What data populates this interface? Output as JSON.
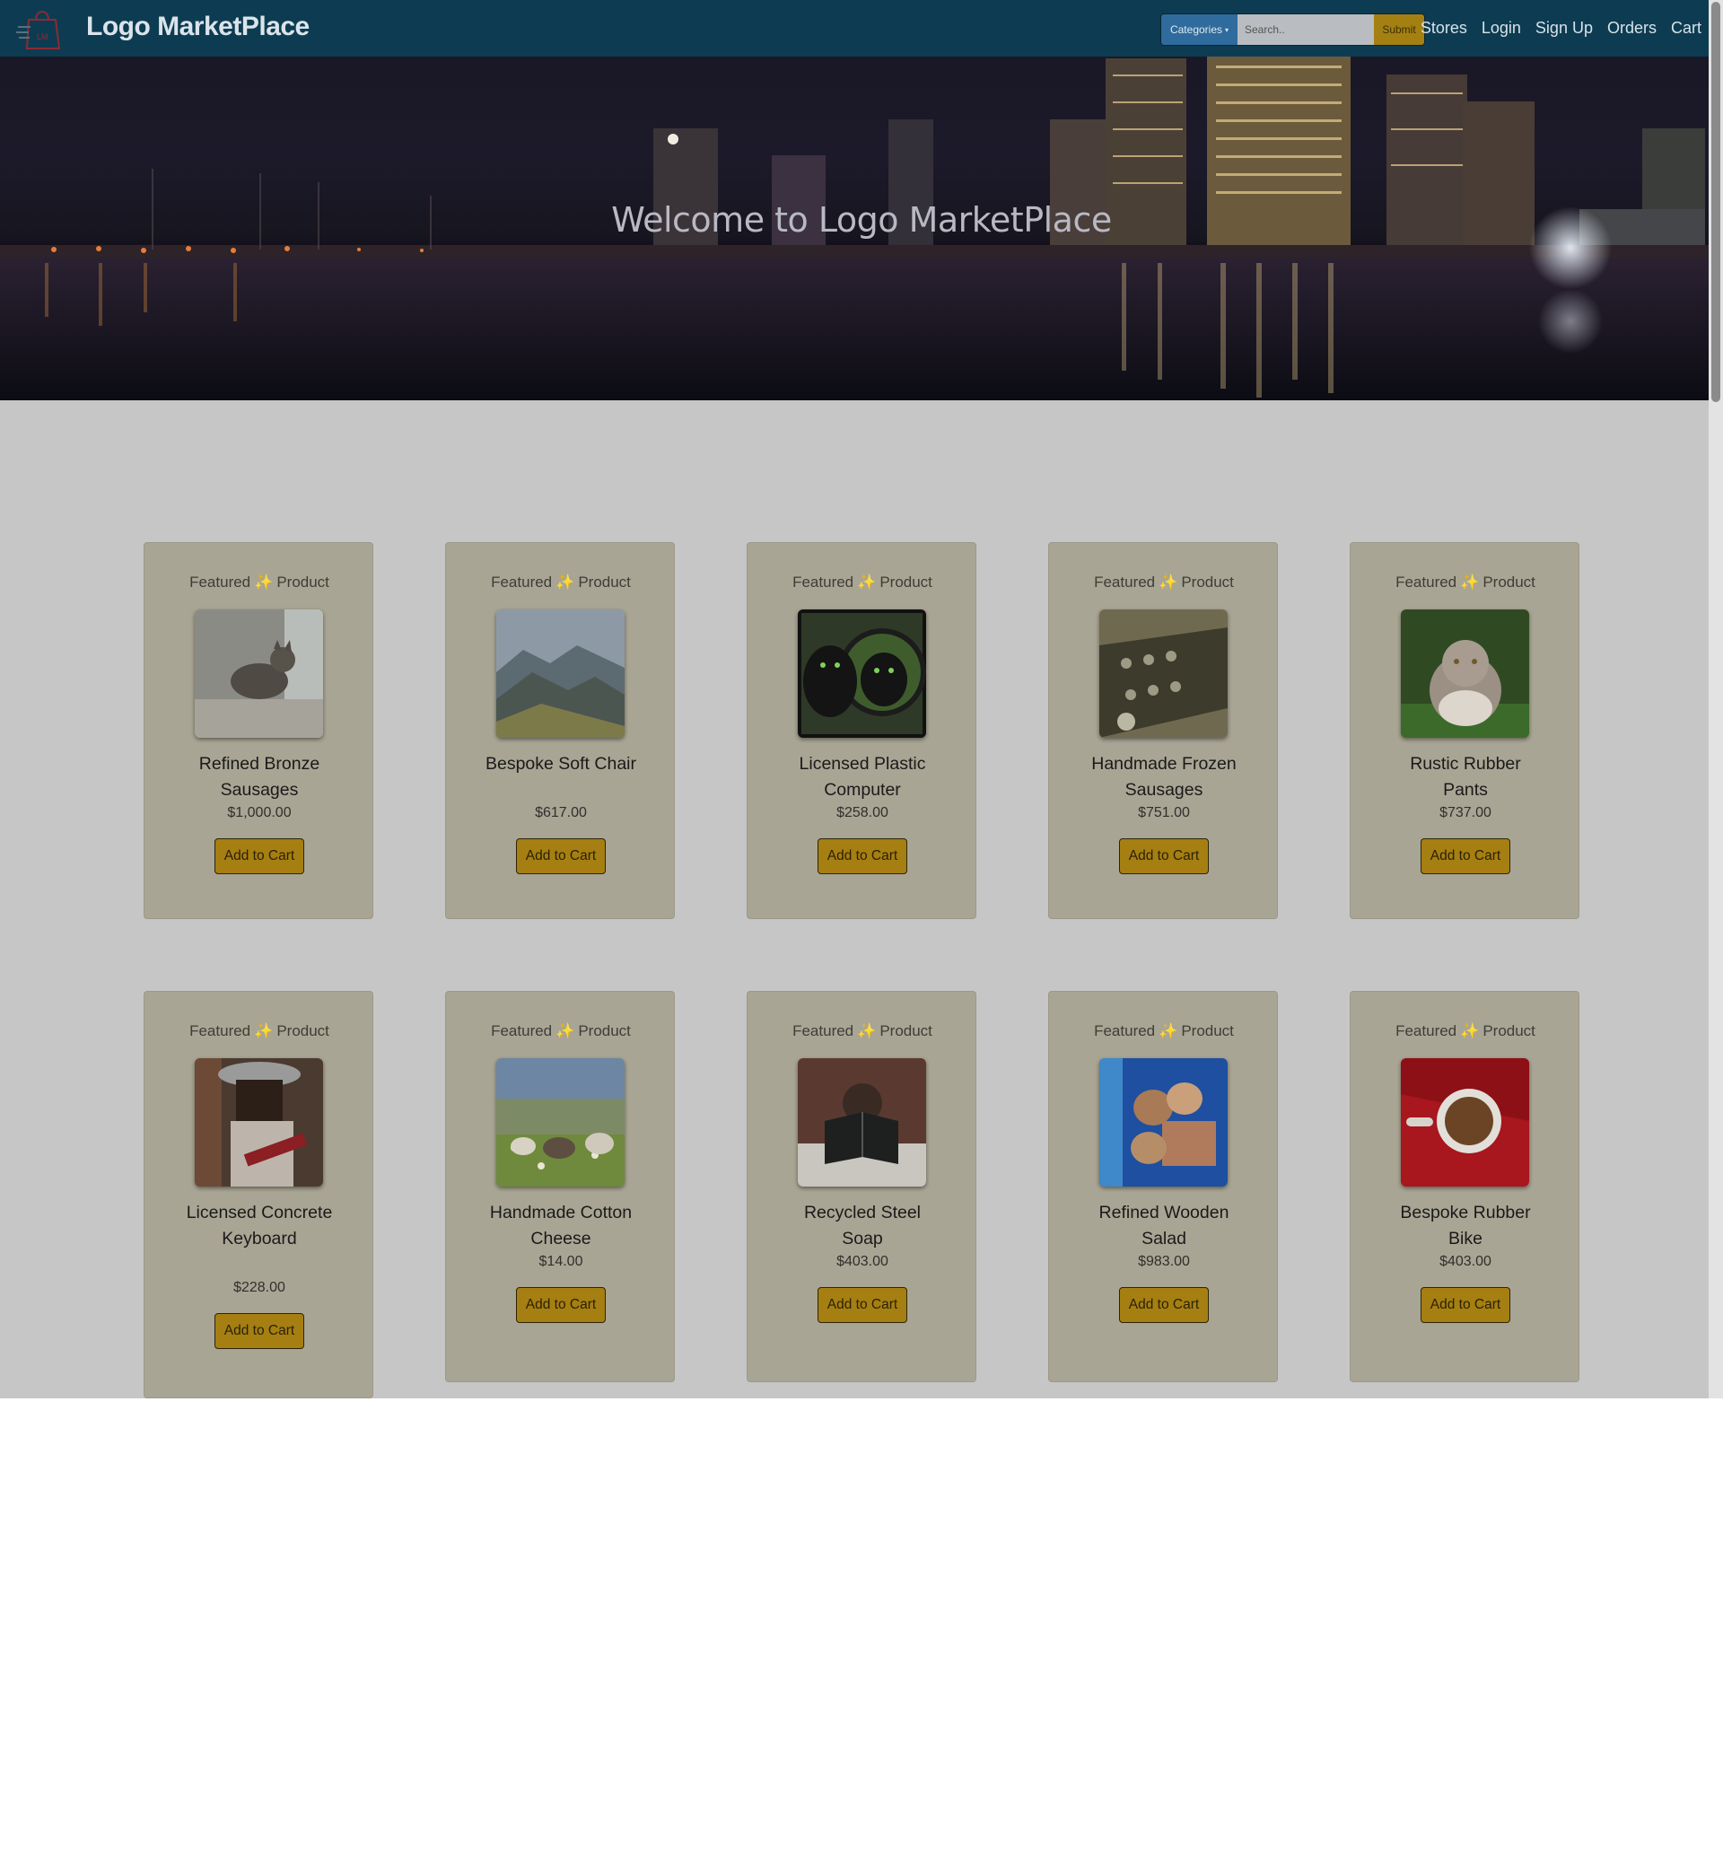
{
  "navbar": {
    "brand": "Logo MarketPlace",
    "logo_text": "LM",
    "categories_label": "Categories",
    "search_placeholder": "Search..",
    "submit_label": "Submit",
    "links": [
      "Stores",
      "Login",
      "Sign Up",
      "Orders",
      "Cart"
    ]
  },
  "hero": {
    "title": "Welcome to Logo MarketPlace"
  },
  "products": [
    {
      "badge_left": "Featured",
      "badge_right": "Product",
      "name": "Refined Bronze Sausages",
      "price": "$1,000.00",
      "button": "Add to Cart"
    },
    {
      "badge_left": "Featured",
      "badge_right": "Product",
      "name": "Bespoke Soft Chair",
      "price": "$617.00",
      "button": "Add to Cart"
    },
    {
      "badge_left": "Featured",
      "badge_right": "Product",
      "name": "Licensed Plastic Computer",
      "price": "$258.00",
      "button": "Add to Cart"
    },
    {
      "badge_left": "Featured",
      "badge_right": "Product",
      "name": "Handmade Frozen Sausages",
      "price": "$751.00",
      "button": "Add to Cart"
    },
    {
      "badge_left": "Featured",
      "badge_right": "Product",
      "name": "Rustic Rubber Pants",
      "price": "$737.00",
      "button": "Add to Cart"
    },
    {
      "badge_left": "Featured",
      "badge_right": "Product",
      "name": "Licensed Concrete Keyboard",
      "price": "$228.00",
      "button": "Add to Cart"
    },
    {
      "badge_left": "Featured",
      "badge_right": "Product",
      "name": "Handmade Cotton Cheese",
      "price": "$14.00",
      "button": "Add to Cart"
    },
    {
      "badge_left": "Featured",
      "badge_right": "Product",
      "name": "Recycled Steel Soap",
      "price": "$403.00",
      "button": "Add to Cart"
    },
    {
      "badge_left": "Featured",
      "badge_right": "Product",
      "name": "Refined Wooden Salad",
      "price": "$983.00",
      "button": "Add to Cart"
    },
    {
      "badge_left": "Featured",
      "badge_right": "Product",
      "name": "Bespoke Rubber Bike",
      "price": "$403.00",
      "button": "Add to Cart"
    }
  ],
  "colors": {
    "navbar": "#0d3c52",
    "accent_gold": "#a67f12",
    "category_blue": "#2f6b9c",
    "card": "#a9a594"
  }
}
